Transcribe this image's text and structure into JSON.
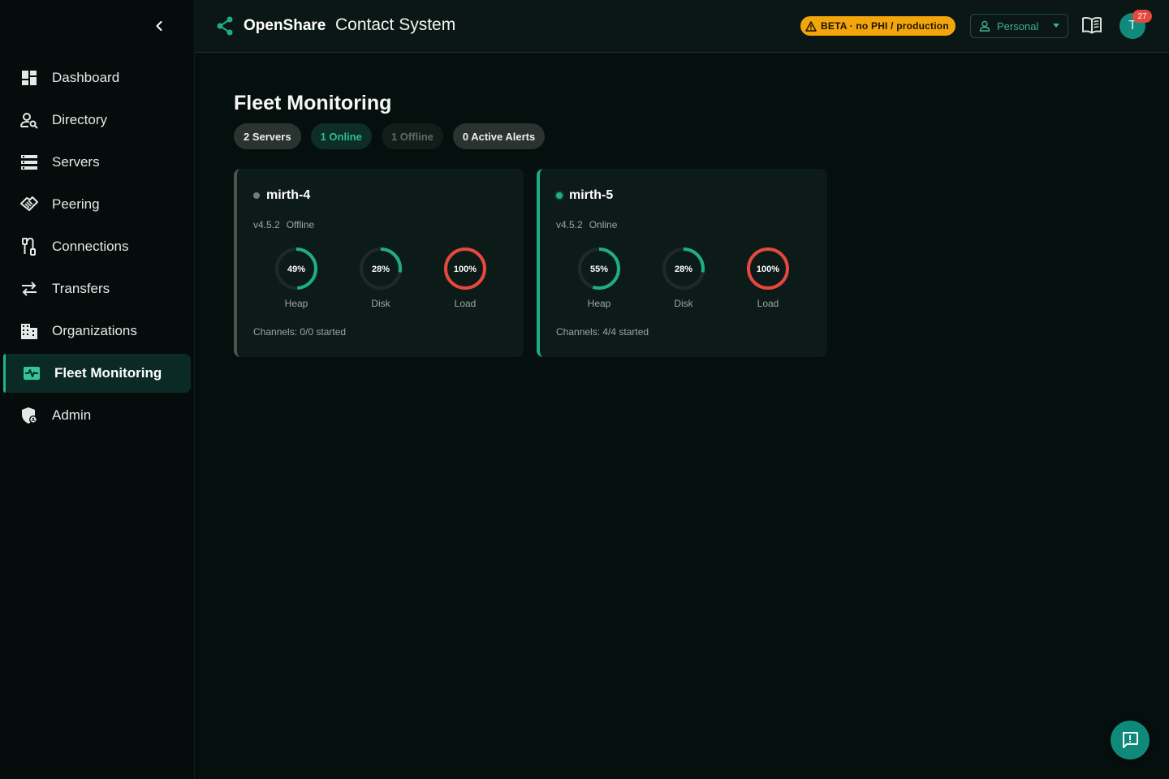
{
  "brand": {
    "name": "OpenShare",
    "app_title": "Contact System"
  },
  "header": {
    "beta_badge": "BETA · no PHI / production",
    "workspace": "Personal",
    "avatar_initial": "T",
    "notification_count": "27"
  },
  "sidebar": {
    "items": [
      {
        "label": "Dashboard",
        "icon": "dashboard-icon"
      },
      {
        "label": "Directory",
        "icon": "person-search-icon"
      },
      {
        "label": "Servers",
        "icon": "servers-icon"
      },
      {
        "label": "Peering",
        "icon": "handshake-icon"
      },
      {
        "label": "Connections",
        "icon": "cable-icon"
      },
      {
        "label": "Transfers",
        "icon": "swap-arrows-icon"
      },
      {
        "label": "Organizations",
        "icon": "building-icon"
      },
      {
        "label": "Fleet Monitoring",
        "icon": "monitor-heart-icon",
        "active": true
      },
      {
        "label": "Admin",
        "icon": "admin-shield-icon"
      }
    ]
  },
  "page": {
    "title": "Fleet Monitoring",
    "pills": {
      "servers": "2 Servers",
      "online": "1 Online",
      "offline": "1 Offline",
      "alerts": "0 Active Alerts"
    }
  },
  "servers": [
    {
      "name": "mirth-4",
      "version": "v4.5.2",
      "status": "Offline",
      "gauges": [
        {
          "label": "Heap",
          "value_text": "49%",
          "value": 49
        },
        {
          "label": "Disk",
          "value_text": "28%",
          "value": 28
        },
        {
          "label": "Load",
          "value_text": "100%",
          "value": 100
        }
      ],
      "channels": "Channels: 0/0 started"
    },
    {
      "name": "mirth-5",
      "version": "v4.5.2",
      "status": "Online",
      "gauges": [
        {
          "label": "Heap",
          "value_text": "55%",
          "value": 55
        },
        {
          "label": "Disk",
          "value_text": "28%",
          "value": 28
        },
        {
          "label": "Load",
          "value_text": "100%",
          "value": 100
        }
      ],
      "channels": "Channels: 4/4 started"
    }
  ],
  "colors": {
    "accent": "#1fae83",
    "danger": "#e5483f",
    "warning": "#f2a60c",
    "track": "#1e2a27"
  }
}
